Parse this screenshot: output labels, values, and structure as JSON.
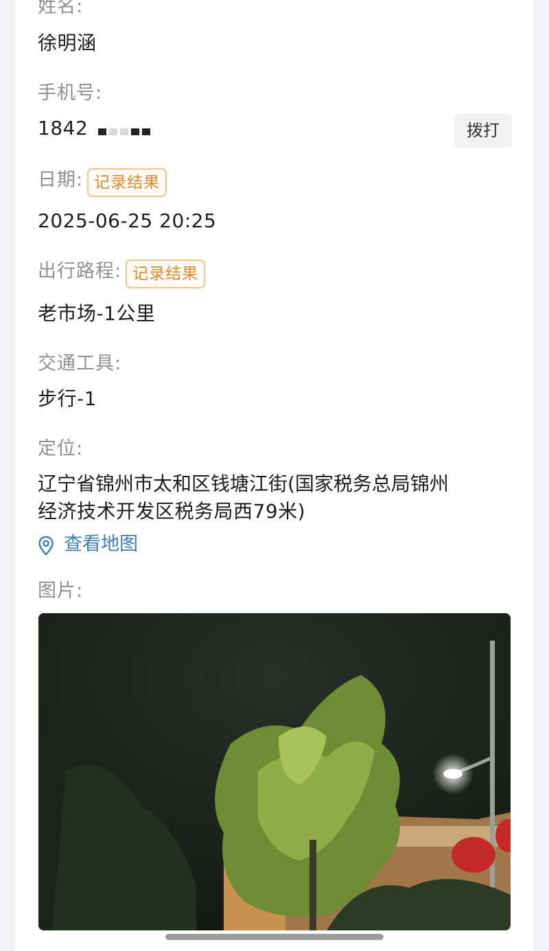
{
  "fields": {
    "name": {
      "label": "姓名:",
      "value": "徐明涵"
    },
    "phone": {
      "label": "手机号:",
      "value": "1842",
      "dial_label": "拨打"
    },
    "date": {
      "label": "日期:",
      "tag": "记录结果",
      "value": "2025-06-25 20:25"
    },
    "route": {
      "label": "出行路程:",
      "tag": "记录结果",
      "value": "老市场-1公里"
    },
    "transport": {
      "label": "交通工具:",
      "value": "步行-1"
    },
    "location": {
      "label": "定位:",
      "line1": "辽宁省锦州市太和区钱塘江街(国家税务总局锦州",
      "line2": "经济技术开发区税务局西79米)",
      "map_link": "查看地图",
      "map_icon": "location-pin-icon"
    },
    "picture": {
      "label": "图片:"
    }
  },
  "colors": {
    "label": "#8f8f94",
    "value": "#1d1d1f",
    "tag_border": "#f3c493",
    "tag_text": "#e08a2c",
    "link": "#3f7fb7"
  }
}
